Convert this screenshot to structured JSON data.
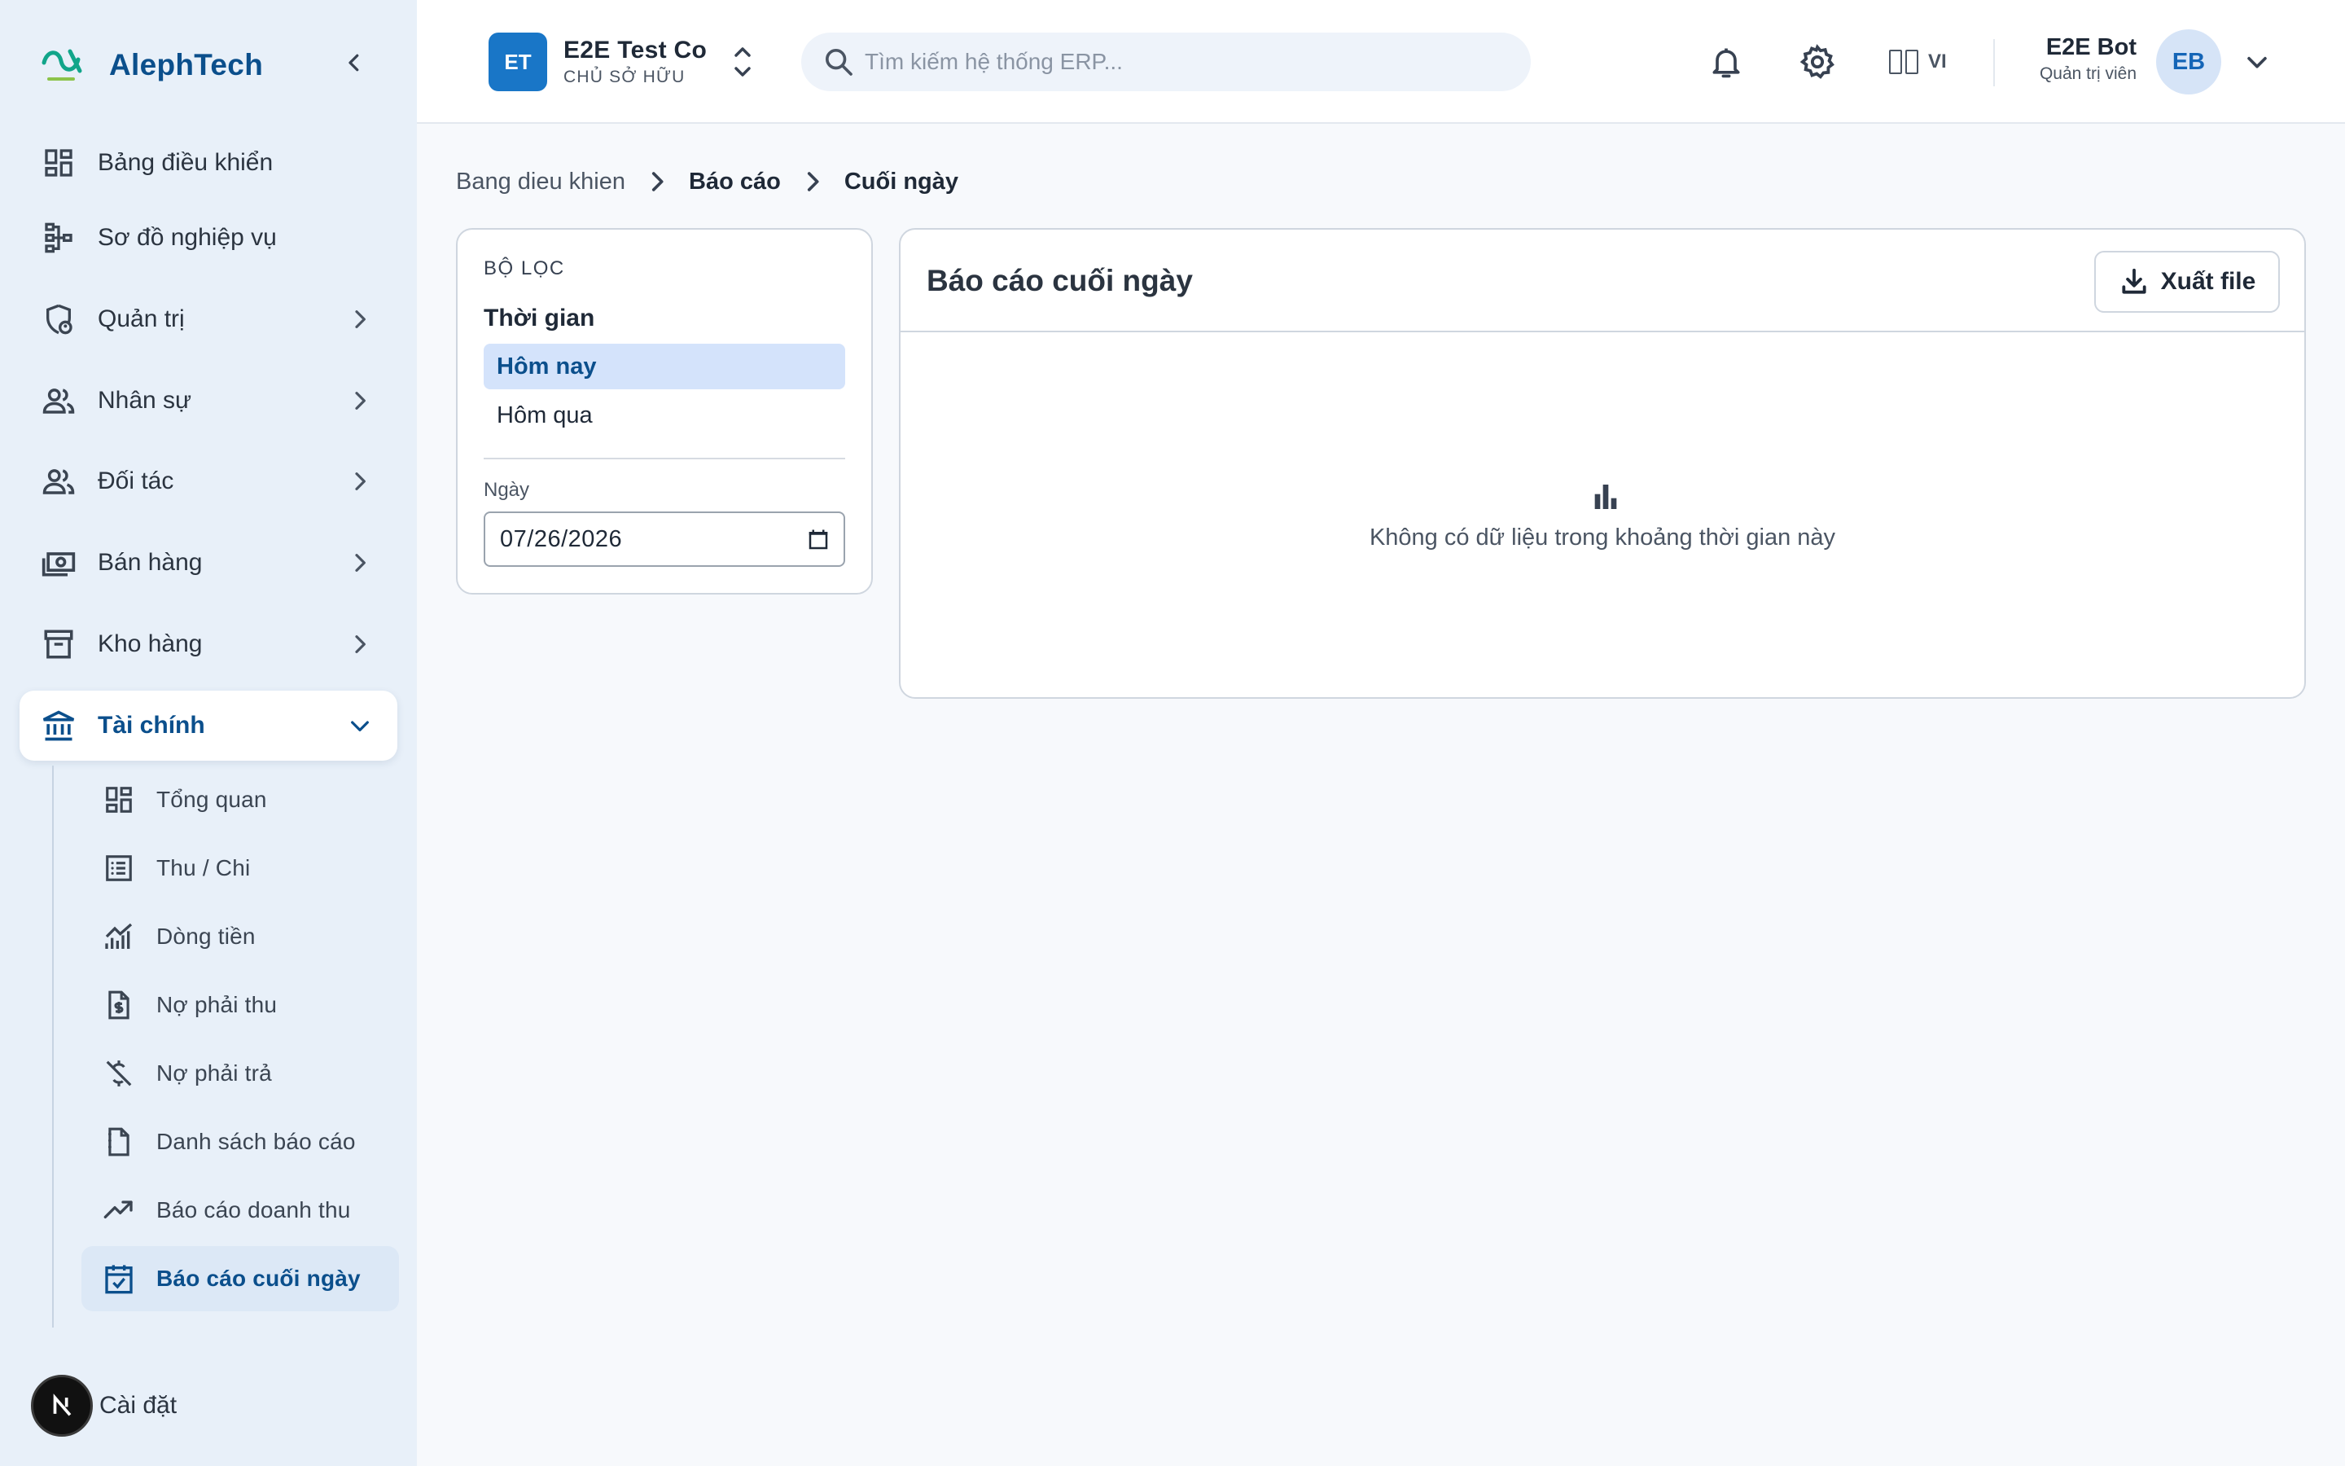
{
  "brand": {
    "name": "AlephTech"
  },
  "sidebar": {
    "items": [
      {
        "label": "Bảng điều khiển",
        "icon": "dashboard-icon"
      },
      {
        "label": "Sơ đồ nghiệp vụ",
        "icon": "sitemap-icon"
      },
      {
        "label": "Quản trị",
        "icon": "admin-shield-icon"
      },
      {
        "label": "Nhân sự",
        "icon": "people-icon"
      },
      {
        "label": "Đối tác",
        "icon": "partners-icon"
      },
      {
        "label": "Bán hàng",
        "icon": "cash-icon"
      },
      {
        "label": "Kho hàng",
        "icon": "archive-icon"
      },
      {
        "label": "Tài chính",
        "icon": "bank-icon"
      }
    ],
    "finance_sub": [
      {
        "label": "Tổng quan",
        "icon": "dashboard-icon"
      },
      {
        "label": "Thu / Chi",
        "icon": "receipt-list-icon"
      },
      {
        "label": "Dòng tiền",
        "icon": "cashflow-chart-icon"
      },
      {
        "label": "Nợ phải thu",
        "icon": "invoice-dollar-icon"
      },
      {
        "label": "Nợ phải trả",
        "icon": "money-off-icon"
      },
      {
        "label": "Danh sách báo cáo",
        "icon": "report-list-icon"
      },
      {
        "label": "Báo cáo doanh thu",
        "icon": "trending-up-icon"
      },
      {
        "label": "Báo cáo cuối ngày",
        "icon": "event-check-icon"
      }
    ],
    "settings_label": "Cài đặt",
    "next_badge": "N"
  },
  "header": {
    "company_initials": "ET",
    "company_name": "E2E Test Co",
    "company_role": "CHỦ SỞ HỮU",
    "search_placeholder": "Tìm kiếm hệ thống ERP...",
    "language": "VI",
    "user_name": "E2E Bot",
    "user_role": "Quản trị viên",
    "user_initials": "EB"
  },
  "breadcrumb": [
    "Bang dieu khien",
    "Báo cáo",
    "Cuối ngày"
  ],
  "filter": {
    "title": "BỘ LỌC",
    "time_label": "Thời gian",
    "options": [
      "Hôm nay",
      "Hôm qua"
    ],
    "selected_option": "Hôm nay",
    "date_label": "Ngày",
    "date_value": "07/26/2026"
  },
  "report": {
    "title": "Báo cáo cuối ngày",
    "export_label": "Xuất file",
    "empty_message": "Không có dữ liệu trong khoảng thời gian này"
  },
  "colors": {
    "brand": "#0b4f8c",
    "sidebar_bg": "#e8f0f9",
    "accent": "#1976c7",
    "selected_bg": "#d4e3fb"
  }
}
